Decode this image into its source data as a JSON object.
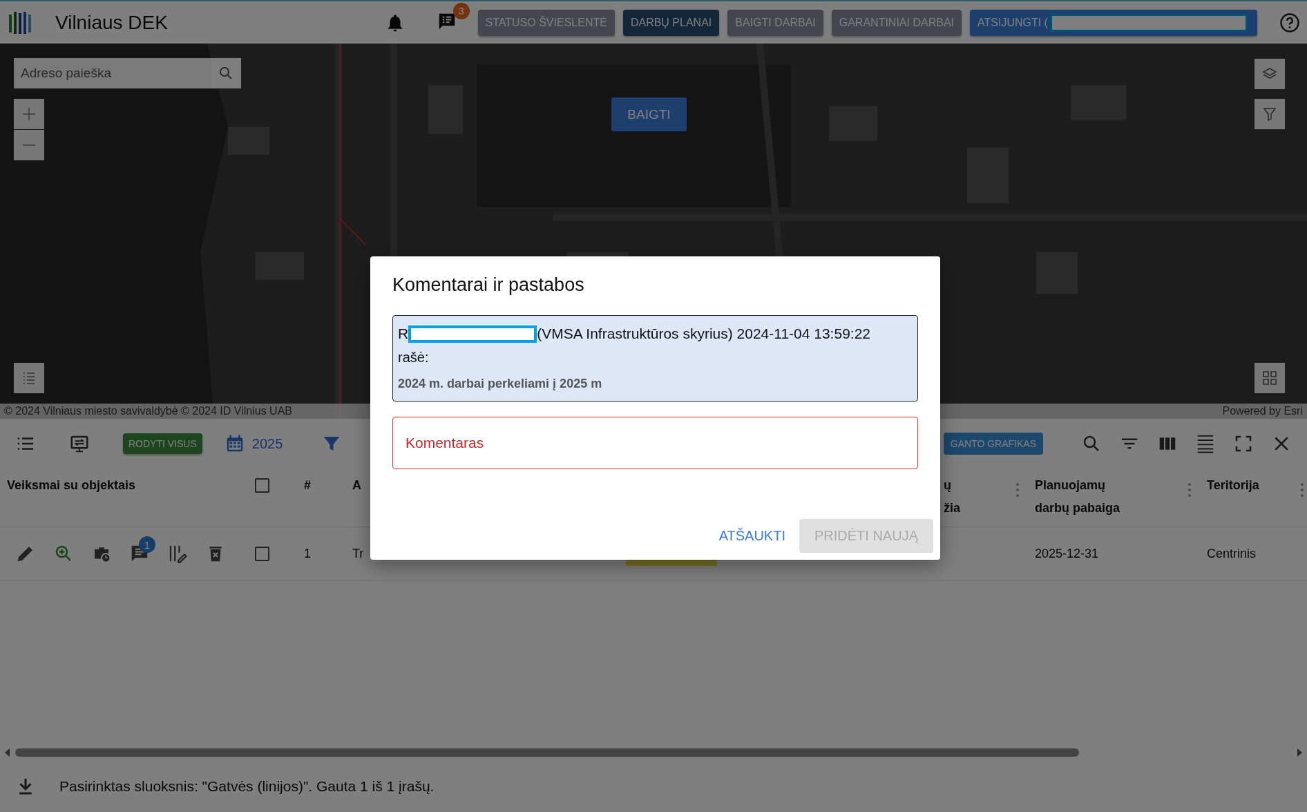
{
  "app": {
    "title": "Vilniaus DEK",
    "messages_badge": "3"
  },
  "nav_buttons": [
    {
      "label": "STATUSO ŠVIESLENTĖ",
      "selected": false
    },
    {
      "label": "DARBŲ PLANAI",
      "selected": true
    },
    {
      "label": "BAIGTI DARBAI",
      "selected": false
    },
    {
      "label": "GARANTINIAI DARBAI",
      "selected": false
    }
  ],
  "logout": {
    "label": "ATSIJUNGTI ("
  },
  "map": {
    "search": {
      "placeholder": "Adreso paieška"
    },
    "finish_button": "BAIGTI",
    "attribution": "© 2024 Vilniaus miesto savivaldybė © 2024 ID Vilnius UAB",
    "powered_by": "Powered by Esri"
  },
  "toolbar": {
    "show_all": "RODYTI VISUS",
    "year": "2025",
    "schedule": "GANTO GRAFIKAS"
  },
  "table": {
    "columns": [
      {
        "kind": "text",
        "lines": [
          "Veiksmai su objektais"
        ]
      },
      {
        "kind": "checkbox",
        "checked": false
      },
      {
        "kind": "text",
        "lines": [
          "#"
        ]
      },
      {
        "kind": "text",
        "lines": [
          "A"
        ]
      },
      {
        "kind": "text",
        "lines": [
          "ų",
          "žia"
        ],
        "menu": true
      },
      {
        "kind": "text",
        "lines": [
          "Planuojamų",
          "darbų pabaiga"
        ],
        "menu": true
      },
      {
        "kind": "text",
        "lines": [
          "Teritorija"
        ],
        "menu": true
      }
    ],
    "rows": [
      {
        "checked": false,
        "number": "1",
        "street": "Tr",
        "comments": "1",
        "end": "2025-12-31",
        "territory": "Centrinis"
      }
    ]
  },
  "status_bar": {
    "text": "Pasirinktas sluoksnis: \"Gatvės (linijos)\". Gauta 1 iš 1 įrašų."
  },
  "dialog": {
    "title": "Komentarai ir pastabos",
    "comments": [
      {
        "author": "R",
        "meta": "(VMSA Infrastruktūros skyrius) 2024-11-04 13:59:22",
        "verb": "rašė:",
        "text": "2024 m. darbai perkeliami į 2025 m"
      }
    ],
    "field": {
      "placeholder": "Komentaras",
      "invalid": true
    },
    "cancel": "ATŠAUKTI",
    "add": {
      "label": "PRIDĖTI NAUJĄ",
      "disabled": true
    }
  }
}
